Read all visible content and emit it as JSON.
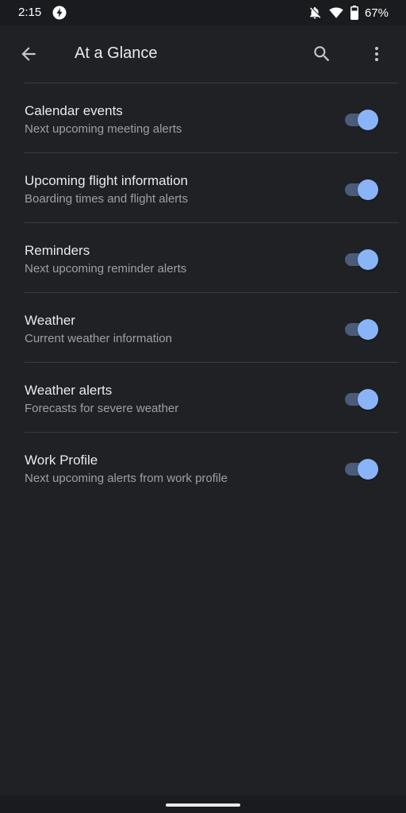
{
  "status_bar": {
    "time": "2:15",
    "battery_percent": "67%",
    "icons": [
      "bolt-icon",
      "notifications-off-icon",
      "wifi-icon",
      "battery-icon"
    ]
  },
  "app_bar": {
    "title": "At a Glance",
    "icons": [
      "back-arrow-icon",
      "search-icon",
      "more-vert-icon"
    ]
  },
  "settings": [
    {
      "title": "Calendar events",
      "subtitle": "Next upcoming meeting alerts",
      "enabled": true
    },
    {
      "title": "Upcoming flight information",
      "subtitle": "Boarding times and flight alerts",
      "enabled": true
    },
    {
      "title": "Reminders",
      "subtitle": "Next upcoming reminder alerts",
      "enabled": true
    },
    {
      "title": "Weather",
      "subtitle": "Current weather information",
      "enabled": true
    },
    {
      "title": "Weather alerts",
      "subtitle": "Forecasts for severe weather",
      "enabled": true
    },
    {
      "title": "Work Profile",
      "subtitle": "Next upcoming alerts from work profile",
      "enabled": true
    }
  ],
  "colors": {
    "background": "#202125",
    "accent": "#8ab4f8",
    "track_on": "#4b5c7a",
    "divider": "#3c3d41"
  }
}
